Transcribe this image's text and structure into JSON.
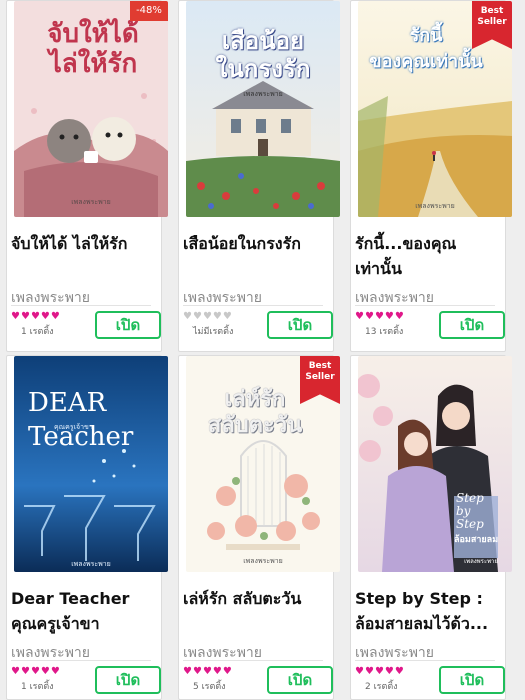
{
  "open_label": "เปิด",
  "accent_color": "#1fbe5b",
  "heart_color": "#e0188a",
  "heart_empty_color": "#c8c8c8",
  "books": [
    {
      "title": "จับให้ได้ ไล่ให้รัก",
      "author": "เพลงพระพาย",
      "rating_count": "1 เรตติ้ง",
      "hearts": 5,
      "badge": "-48%",
      "badge_type": "discount",
      "cover_title": "จับให้ได้\nไล่ให้รัก",
      "cover_author": "เพลงพระพาย"
    },
    {
      "title": "เสือน้อยในกรงรัก",
      "author": "เพลงพระพาย",
      "rating_count": "ไม่มีเรตติ้ง",
      "hearts": 0,
      "badge": "",
      "badge_type": "",
      "cover_title": "เสือน้อย\nในกรงรัก",
      "cover_author": "เพลงพระพาย"
    },
    {
      "title": "รักนี้...ของคุณ\nเท่านั้น",
      "author": "เพลงพระพาย",
      "rating_count": "13 เรตติ้ง",
      "hearts": 5,
      "badge": "Best Seller",
      "badge_type": "ribbon",
      "cover_title": "รักนี้\nของคุณเท่านั้น",
      "cover_author": "เพลงพระพาย"
    },
    {
      "title": "Dear Teacher\nคุณครูเจ้าขา",
      "author": "เพลงพระพาย",
      "rating_count": "1 เรตติ้ง",
      "hearts": 5,
      "badge": "",
      "badge_type": "",
      "cover_title": "DEAR\nTeacher",
      "cover_subtitle": "คุณครูเจ้าขา",
      "cover_author": "เพลงพระพาย"
    },
    {
      "title": "เล่ห์รัก สลับตะวัน",
      "author": "เพลงพระพาย",
      "rating_count": "5 เรตติ้ง",
      "hearts": 5,
      "badge": "Best Seller",
      "badge_type": "ribbon",
      "cover_title": "เล่ห์รัก\nสลับตะวัน",
      "cover_author": "เพลงพระพาย"
    },
    {
      "title": "Step by Step :\nล้อมสายลมไว้ด้ว...",
      "author": "เพลงพระพาย",
      "rating_count": "2 เรตติ้ง",
      "hearts": 5,
      "badge": "",
      "badge_type": "",
      "cover_title": "Step\nby\nStep",
      "cover_subtitle": "ล้อมสายลม",
      "cover_author": "เพลงพระพาย"
    }
  ]
}
